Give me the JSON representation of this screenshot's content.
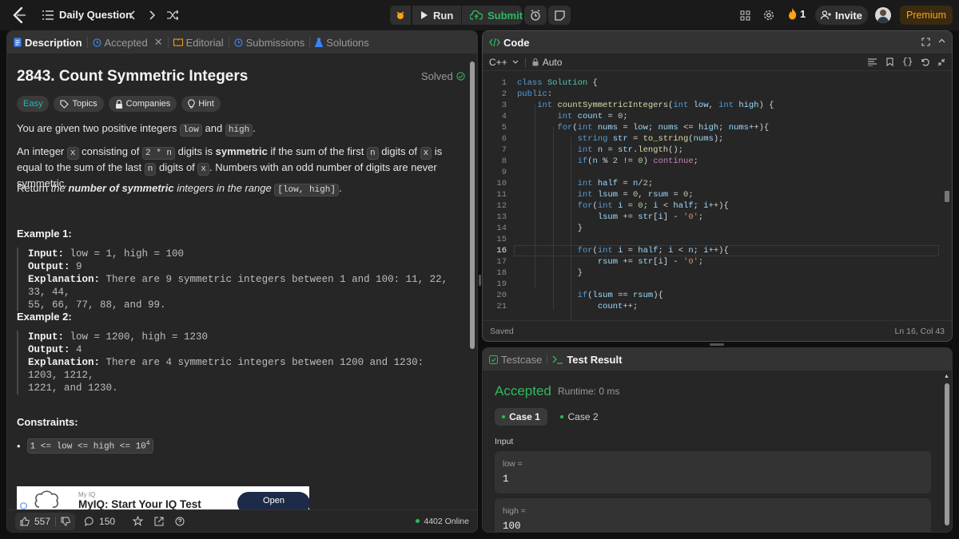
{
  "header": {
    "title": "Daily Question",
    "run": "Run",
    "submit": "Submit",
    "streak": "1",
    "invite": "Invite",
    "premium": "Premium"
  },
  "left_tabs": [
    "Description",
    "Accepted",
    "Editorial",
    "Submissions",
    "Solutions"
  ],
  "problem": {
    "title": "2843. Count Symmetric Integers",
    "status": "Solved",
    "chips": [
      "Easy",
      "Topics",
      "Companies",
      "Hint"
    ],
    "p1_a": "You are given two positive integers",
    "p1_low": "low",
    "p1_and": "and",
    "p1_high": "high",
    "p1_end": ".",
    "p2_a": "An integer",
    "p2_x": "x",
    "p2_b": "consisting of",
    "p2_2n": "2 * n",
    "p2_c": "digits is",
    "p2_sym": "symmetric",
    "p2_d": "if the sum of the first",
    "p2_n": "n",
    "p2_e": "digits of",
    "p2_x2": "x",
    "p2_f": "is equal to the sum of",
    "p2_g": "the last",
    "p2_n2": "n",
    "p2_h": "digits of",
    "p2_x3": "x",
    "p2_i": ". Numbers with an odd number of digits are never symmetric.",
    "p3_a": "Return",
    "p3_b": "the",
    "p3_c": "number of symmetric",
    "p3_d": "integers in the range",
    "p3_range": "[low, high]",
    "p3_e": ".",
    "ex1_title": "Example 1:",
    "ex1_input_k": "Input:",
    "ex1_input_v": "low = 1, high = 100",
    "ex1_output_k": "Output:",
    "ex1_output_v": "9",
    "ex1_expl_k": "Explanation:",
    "ex1_expl_v1": "There are 9 symmetric integers between 1 and 100: 11, 22, 33, 44,",
    "ex1_expl_v2": "55, 66, 77, 88, and 99.",
    "ex2_title": "Example 2:",
    "ex2_input_k": "Input:",
    "ex2_input_v": "low = 1200, high = 1230",
    "ex2_output_k": "Output:",
    "ex2_output_v": "4",
    "ex2_expl_k": "Explanation:",
    "ex2_expl_v1": "There are 4 symmetric integers between 1200 and 1230: 1203, 1212,",
    "ex2_expl_v2": "1221, and 1230.",
    "constraints_title": "Constraints:",
    "constraint": "1 <= low <= high <= 10",
    "constraint_sup": "4"
  },
  "ad": {
    "brand": "My IQ",
    "title": "MyIQ: Start Your IQ Test",
    "button": "Open"
  },
  "left_footer": {
    "likes": "557",
    "comments": "150",
    "online": "4402 Online"
  },
  "code_panel": {
    "title": "Code",
    "language": "C++",
    "mode": "Auto",
    "saved": "Saved",
    "cursor": "Ln 16, Col 43",
    "current_line": 16
  },
  "code_lines": [
    "class Solution {",
    "public:",
    "    int countSymmetricIntegers(int low, int high) {",
    "        int count = 0;",
    "        for(int nums = low; nums <= high; nums++){",
    "            string str = to_string(nums);",
    "            int n = str.length();",
    "            if(n % 2 != 0) continue;",
    "",
    "            int half = n/2;",
    "            int lsum = 0, rsum = 0;",
    "            for(int i = 0; i < half; i++){",
    "                lsum += str[i] - '0';",
    "            }",
    "",
    "            for(int i = half; i < n; i++){",
    "                rsum += str[i] - '0';",
    "            }",
    "",
    "            if(lsum == rsum){",
    "                count++;"
  ],
  "result_panel": {
    "tab_testcase": "Testcase",
    "tab_result": "Test Result",
    "verdict": "Accepted",
    "runtime": "Runtime: 0 ms",
    "case1": "Case 1",
    "case2": "Case 2",
    "input_label": "Input",
    "var1_name": "low =",
    "var1_value": "1",
    "var2_name": "high =",
    "var2_value": "100"
  },
  "colors": {
    "accent_green": "#2cbb5d",
    "easy": "#1cbaba",
    "premium": "#ffa116",
    "panel_bg": "#262626"
  }
}
